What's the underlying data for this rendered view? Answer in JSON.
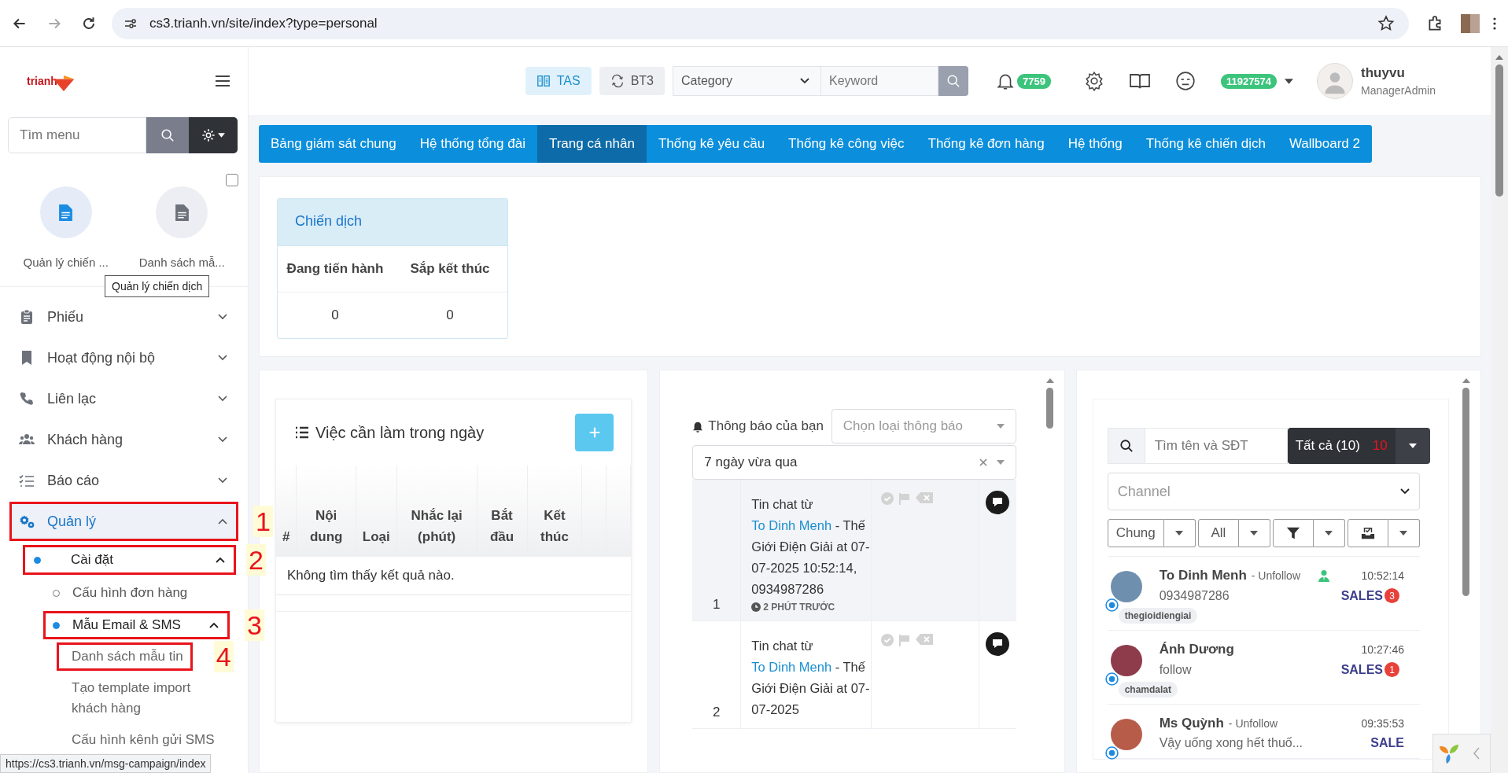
{
  "browser": {
    "url": "cs3.trianh.vn/site/index?type=personal",
    "status_url": "https://cs3.trianh.vn/msg-campaign/index"
  },
  "sidebar": {
    "logo": "trianh",
    "search_placeholder": "Tìm menu",
    "checkbox": {
      "checked": false
    },
    "shortcuts": [
      {
        "label": "Quản lý chiến ...",
        "selected": true
      },
      {
        "label": "Danh sách mẫ...",
        "selected": false
      }
    ],
    "tooltip": "Quản lý chiến dịch",
    "menu": [
      {
        "label": "Phiếu",
        "selected": false,
        "expanded": false
      },
      {
        "label": "Hoạt động nội bộ",
        "selected": false,
        "expanded": false
      },
      {
        "label": "Liên lạc",
        "selected": false,
        "expanded": false
      },
      {
        "label": "Khách hàng",
        "selected": false,
        "expanded": false
      },
      {
        "label": "Báo cáo",
        "selected": false,
        "expanded": false
      },
      {
        "label": "Quản lý",
        "selected": true,
        "expanded": true,
        "annotation": "1",
        "children": [
          {
            "label": "Cài đặt",
            "selected": true,
            "expanded": true,
            "annotation": "2",
            "children": [
              {
                "label": "Cấu hình đơn hàng",
                "selected": false
              },
              {
                "label": "Mẫu Email & SMS",
                "selected": true,
                "expanded": true,
                "annotation": "3",
                "children": [
                  {
                    "label": "Danh sách mẫu tin",
                    "selected": false,
                    "annotation": "4"
                  },
                  {
                    "label": "Tạo template import khách hàng",
                    "selected": false
                  },
                  {
                    "label": "Cấu hình kênh gửi SMS",
                    "selected": false
                  }
                ]
              }
            ]
          }
        ]
      }
    ]
  },
  "header": {
    "buttons": [
      {
        "label": "TAS",
        "selected": true
      },
      {
        "label": "BT3",
        "selected": false
      }
    ],
    "category_placeholder": "Category",
    "keyword_placeholder": "Keyword",
    "notifications": "7759",
    "points": "11927574",
    "user": {
      "name": "thuyvu",
      "role": "ManagerAdmin"
    }
  },
  "tabs": [
    {
      "label": "Bảng giám sát chung",
      "selected": false
    },
    {
      "label": "Hệ thống tổng đài",
      "selected": false
    },
    {
      "label": "Trang cá nhân",
      "selected": true
    },
    {
      "label": "Thống kê yêu cầu",
      "selected": false
    },
    {
      "label": "Thống kê công việc",
      "selected": false
    },
    {
      "label": "Thống kê đơn hàng",
      "selected": false
    },
    {
      "label": "Hệ thống",
      "selected": false
    },
    {
      "label": "Thống kê chiến dịch",
      "selected": false
    },
    {
      "label": "Wallboard 2",
      "selected": false
    }
  ],
  "campaign": {
    "title": "Chiến dịch",
    "columns": [
      "Đang tiến hành",
      "Sắp kết thúc"
    ],
    "values": [
      "0",
      "0"
    ]
  },
  "tasks": {
    "title": "Việc cần làm trong ngày",
    "columns": [
      "#",
      "Nội dung",
      "Loại",
      "Nhắc lại (phút)",
      "Bắt đầu",
      "Kết thúc"
    ],
    "empty": "Không tìm thấy kết quả nào."
  },
  "notifications": {
    "title": "Thông báo của bạn",
    "type_placeholder": "Chọn loại thông báo",
    "period": "7 ngày vừa qua",
    "items": [
      {
        "index": "1",
        "prefix": "Tin chat từ",
        "contact": "To Dinh Menh",
        "suffix": "- Thế Giới Điện Giải at 07-07-2025 10:52:14, 0934987286",
        "ago": "2 PHÚT TRƯỚC",
        "unread": true
      },
      {
        "index": "2",
        "prefix": "Tin chat từ",
        "contact": "To Dinh Menh",
        "suffix": "- Thế Giới Điện Giải at 07-07-2025",
        "unread": false
      }
    ]
  },
  "chats": {
    "search_placeholder": "Tìm tên và SĐT",
    "filter": "Tất cả (10)",
    "unread": "10",
    "channel_placeholder": "Channel",
    "filters": [
      {
        "kind": "text",
        "label": "Chung"
      },
      {
        "kind": "text",
        "label": "All"
      },
      {
        "kind": "filter"
      },
      {
        "kind": "inbox"
      }
    ],
    "conversations": [
      {
        "name": "To Dinh Menh",
        "status": "- Unfollow",
        "assigned": true,
        "time": "10:52:14",
        "preview": "0934987286",
        "team": "SALES",
        "badge": "3",
        "tag": "thegioidiengiai"
      },
      {
        "name": "Ánh Dương",
        "assigned": false,
        "time": "10:27:46",
        "preview": "follow",
        "team": "SALES",
        "badge": "1",
        "tag": "chamdalat"
      },
      {
        "name": "Ms Quỳnh",
        "status": "- Unfollow",
        "assigned": false,
        "time": "09:35:53",
        "preview": "Vậy uống xong hết thuố...",
        "team": "SALE"
      }
    ]
  }
}
